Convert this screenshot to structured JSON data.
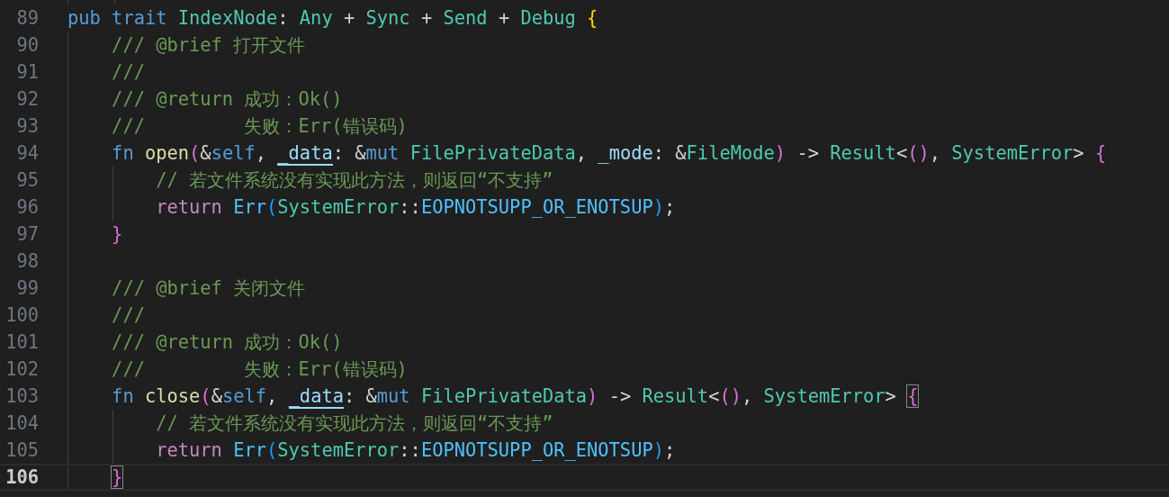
{
  "editor": {
    "lines": [
      {
        "number": "89",
        "current": false,
        "tokens": [
          {
            "text": "pub ",
            "kind": "keyword"
          },
          {
            "text": "trait ",
            "kind": "keyword"
          },
          {
            "text": "IndexNode",
            "kind": "type"
          },
          {
            "text": ": ",
            "kind": "plain"
          },
          {
            "text": "Any",
            "kind": "type"
          },
          {
            "text": " + ",
            "kind": "plain"
          },
          {
            "text": "Sync",
            "kind": "type"
          },
          {
            "text": " + ",
            "kind": "plain"
          },
          {
            "text": "Send",
            "kind": "type"
          },
          {
            "text": " + ",
            "kind": "plain"
          },
          {
            "text": "Debug ",
            "kind": "type"
          },
          {
            "text": "{",
            "kind": "bracket1"
          }
        ]
      },
      {
        "number": "90",
        "current": false,
        "tokens": [
          {
            "text": "    /// @brief 打开文件",
            "kind": "comment"
          }
        ]
      },
      {
        "number": "91",
        "current": false,
        "tokens": [
          {
            "text": "    ///",
            "kind": "comment"
          }
        ]
      },
      {
        "number": "92",
        "current": false,
        "tokens": [
          {
            "text": "    /// @return 成功：Ok()",
            "kind": "comment"
          }
        ]
      },
      {
        "number": "93",
        "current": false,
        "tokens": [
          {
            "text": "    ///         失败：Err(错误码)",
            "kind": "comment"
          }
        ]
      },
      {
        "number": "94",
        "current": false,
        "tokens": [
          {
            "text": "    fn ",
            "kind": "keyword"
          },
          {
            "text": "open",
            "kind": "function"
          },
          {
            "text": "(",
            "kind": "bracket2"
          },
          {
            "text": "&",
            "kind": "plain"
          },
          {
            "text": "self",
            "kind": "keyword"
          },
          {
            "text": ", ",
            "kind": "plain"
          },
          {
            "text": "_data",
            "kind": "underlined"
          },
          {
            "text": ": &",
            "kind": "plain"
          },
          {
            "text": "mut ",
            "kind": "keyword"
          },
          {
            "text": "FilePrivateData",
            "kind": "type"
          },
          {
            "text": ", ",
            "kind": "plain"
          },
          {
            "text": "_mode",
            "kind": "variable"
          },
          {
            "text": ": &",
            "kind": "plain"
          },
          {
            "text": "FileMode",
            "kind": "type"
          },
          {
            "text": ")",
            "kind": "bracket2"
          },
          {
            "text": " -> ",
            "kind": "plain"
          },
          {
            "text": "Result",
            "kind": "type"
          },
          {
            "text": "<",
            "kind": "plain"
          },
          {
            "text": "()",
            "kind": "bracket2"
          },
          {
            "text": ", ",
            "kind": "plain"
          },
          {
            "text": "SystemError",
            "kind": "type"
          },
          {
            "text": "> ",
            "kind": "plain"
          },
          {
            "text": "{",
            "kind": "bracket2"
          }
        ]
      },
      {
        "number": "95",
        "current": false,
        "tokens": [
          {
            "text": "        // 若文件系统没有实现此方法，则返回“不支持”",
            "kind": "comment"
          }
        ]
      },
      {
        "number": "96",
        "current": false,
        "tokens": [
          {
            "text": "        return ",
            "kind": "control"
          },
          {
            "text": "Err",
            "kind": "enum"
          },
          {
            "text": "(",
            "kind": "bracket3"
          },
          {
            "text": "SystemError",
            "kind": "type"
          },
          {
            "text": "::",
            "kind": "plain"
          },
          {
            "text": "EOPNOTSUPP_OR_ENOTSUP",
            "kind": "enum"
          },
          {
            "text": ")",
            "kind": "bracket3"
          },
          {
            "text": ";",
            "kind": "plain"
          }
        ]
      },
      {
        "number": "97",
        "current": false,
        "tokens": [
          {
            "text": "    }",
            "kind": "bracket2"
          }
        ]
      },
      {
        "number": "98",
        "current": false
      },
      {
        "number": "99",
        "current": false,
        "tokens": [
          {
            "text": "    /// @brief 关闭文件",
            "kind": "comment"
          }
        ]
      },
      {
        "number": "100",
        "current": false,
        "tokens": [
          {
            "text": "    ///",
            "kind": "comment"
          }
        ]
      },
      {
        "number": "101",
        "current": false,
        "tokens": [
          {
            "text": "    /// @return 成功：Ok()",
            "kind": "comment"
          }
        ]
      },
      {
        "number": "102",
        "current": false,
        "tokens": [
          {
            "text": "    ///         失败：Err(错误码)",
            "kind": "comment"
          }
        ]
      },
      {
        "number": "103",
        "current": false,
        "tokens": [
          {
            "text": "    fn ",
            "kind": "keyword"
          },
          {
            "text": "close",
            "kind": "function"
          },
          {
            "text": "(",
            "kind": "bracket2"
          },
          {
            "text": "&",
            "kind": "plain"
          },
          {
            "text": "self",
            "kind": "keyword"
          },
          {
            "text": ", ",
            "kind": "plain"
          },
          {
            "text": "_data",
            "kind": "underlined"
          },
          {
            "text": ": &",
            "kind": "plain"
          },
          {
            "text": "mut ",
            "kind": "keyword"
          },
          {
            "text": "FilePrivateData",
            "kind": "type"
          },
          {
            "text": ")",
            "kind": "bracket2"
          },
          {
            "text": " -> ",
            "kind": "plain"
          },
          {
            "text": "Result",
            "kind": "type"
          },
          {
            "text": "<",
            "kind": "plain"
          },
          {
            "text": "()",
            "kind": "bracket2"
          },
          {
            "text": ", ",
            "kind": "plain"
          },
          {
            "text": "SystemError",
            "kind": "type"
          },
          {
            "text": "> ",
            "kind": "plain"
          },
          {
            "text": "{",
            "kind": "bracket-match"
          }
        ]
      },
      {
        "number": "104",
        "current": false,
        "tokens": [
          {
            "text": "        // 若文件系统没有实现此方法，则返回“不支持”",
            "kind": "comment"
          }
        ]
      },
      {
        "number": "105",
        "current": false,
        "tokens": [
          {
            "text": "        return ",
            "kind": "control"
          },
          {
            "text": "Err",
            "kind": "enum"
          },
          {
            "text": "(",
            "kind": "bracket3"
          },
          {
            "text": "SystemError",
            "kind": "type"
          },
          {
            "text": "::",
            "kind": "plain"
          },
          {
            "text": "EOPNOTSUPP_OR_ENOTSUP",
            "kind": "enum"
          },
          {
            "text": ")",
            "kind": "bracket3"
          },
          {
            "text": ";",
            "kind": "plain"
          }
        ]
      },
      {
        "number": "106",
        "current": true,
        "tokens": [
          {
            "text": "    }",
            "kind": "bracket-match"
          }
        ]
      }
    ]
  }
}
